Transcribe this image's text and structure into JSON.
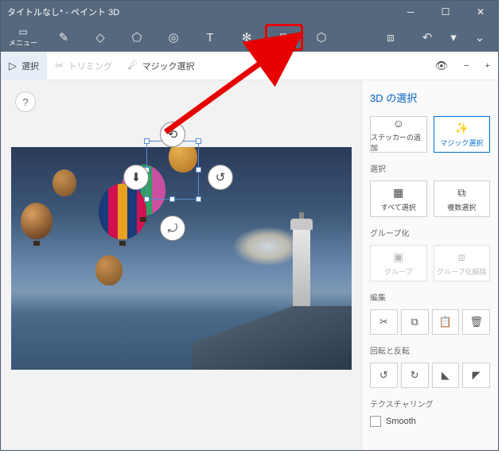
{
  "title": "タイトルなし* - ペイント 3D",
  "menu_label": "メニュー",
  "toolbar": {
    "select": "選択",
    "trim": "トリミング",
    "magic": "マジック選択"
  },
  "help": "?",
  "sidebar": {
    "title": "3D の選択",
    "add_sticker": "ステッカーの追加",
    "magic_select": "マジック選択",
    "sel_label": "選択",
    "select_all": "すべて選択",
    "multi_select": "複数選択",
    "group_label": "グループ化",
    "group": "グループ",
    "ungroup": "グループ化解除",
    "edit_label": "編集",
    "rotate_label": "回転と反転",
    "texture_label": "テクスチャリング",
    "smooth": "Smooth"
  }
}
